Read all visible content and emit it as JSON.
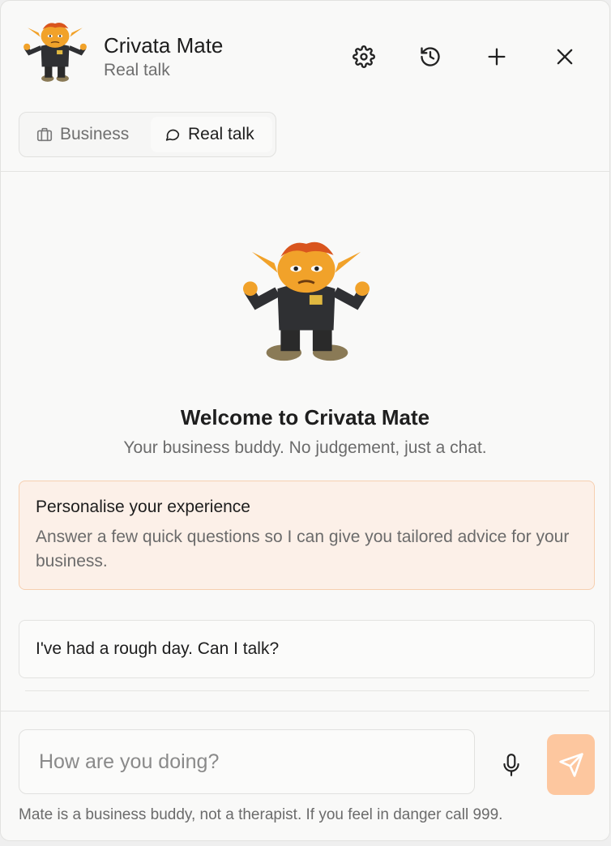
{
  "header": {
    "title": "Crivata Mate",
    "subtitle": "Real talk",
    "icons": [
      "gear-icon",
      "history-icon",
      "plus-icon",
      "close-icon"
    ]
  },
  "tabs": [
    {
      "label": "Business",
      "icon": "briefcase-icon",
      "active": false
    },
    {
      "label": "Real talk",
      "icon": "chat-bubble-icon",
      "active": true
    }
  ],
  "welcome": {
    "title": "Welcome to Crivata Mate",
    "subtitle": "Your business buddy. No judgement, just a chat."
  },
  "personalise": {
    "title": "Personalise your experience",
    "description": "Answer a few quick questions so I can give you tailored advice for your business."
  },
  "suggestions": [
    {
      "label": "I've had a rough day. Can I talk?"
    }
  ],
  "composer": {
    "placeholder": "How are you doing?",
    "value": "",
    "disclaimer": "Mate is a business buddy, not a therapist. If you feel in danger call 999."
  },
  "colors": {
    "accent": "#fdc79f",
    "card_bg": "#fcf0e8",
    "card_border": "#f6cfb0"
  }
}
